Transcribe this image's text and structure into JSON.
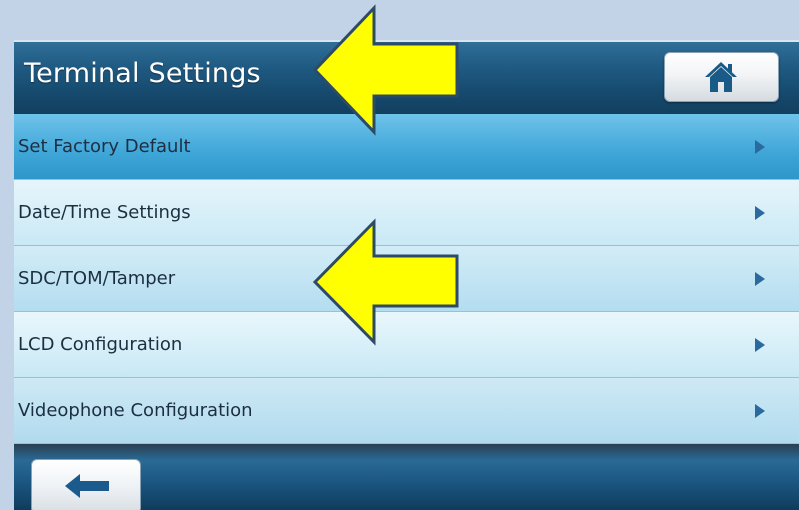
{
  "header": {
    "title": "Terminal Settings",
    "home_icon": "home-icon"
  },
  "menu": {
    "items": [
      {
        "label": "Set Factory Default",
        "selected": true
      },
      {
        "label": "Date/Time Settings",
        "selected": false
      },
      {
        "label": "SDC/TOM/Tamper",
        "selected": false
      },
      {
        "label": "LCD Configuration",
        "selected": false
      },
      {
        "label": "Videophone Configuration",
        "selected": false
      }
    ],
    "chevron_icon": "chevron-right-icon"
  },
  "footer": {
    "back_icon": "back-arrow-icon"
  },
  "annotations": {
    "arrow_color": "#ffff00",
    "arrow_outline": "#2d4a66",
    "targets": [
      "header-title",
      "menu-item-sdc-tom-tamper"
    ]
  },
  "colors": {
    "background": "#c2d3e8",
    "header": "#1f5a82",
    "selected_row": "#3fa6d8",
    "chevron": "#2a6a9e"
  }
}
